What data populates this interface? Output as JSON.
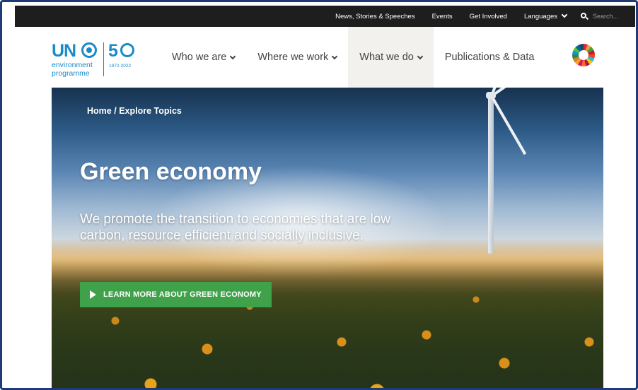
{
  "utility_bar": {
    "links": [
      "News, Stories & Speeches",
      "Events",
      "Get Involved"
    ],
    "languages_label": "Languages",
    "search_placeholder": "Search..."
  },
  "logo": {
    "un": "UN",
    "line1": "environment",
    "line2": "programme",
    "fifty": "5",
    "years": "1972-2022"
  },
  "nav": {
    "items": [
      {
        "label": "Who we are"
      },
      {
        "label": "Where we work"
      },
      {
        "label": "What we do"
      },
      {
        "label": "Publications & Data"
      }
    ]
  },
  "hero": {
    "breadcrumb_home": "Home",
    "breadcrumb_sep": "/",
    "breadcrumb_current": "Explore Topics",
    "title": "Green economy",
    "description": "We promote the transition to economies that are low carbon, resource efficient and socially inclusive.",
    "cta_label": "LEARN MORE ABOUT GREEN ECONOMY"
  },
  "colors": {
    "brand_blue": "#1b8ac9",
    "cta_green": "#3fa24a",
    "utility_bar_bg": "#1e1e1e",
    "frame_border": "#1f3a78"
  }
}
